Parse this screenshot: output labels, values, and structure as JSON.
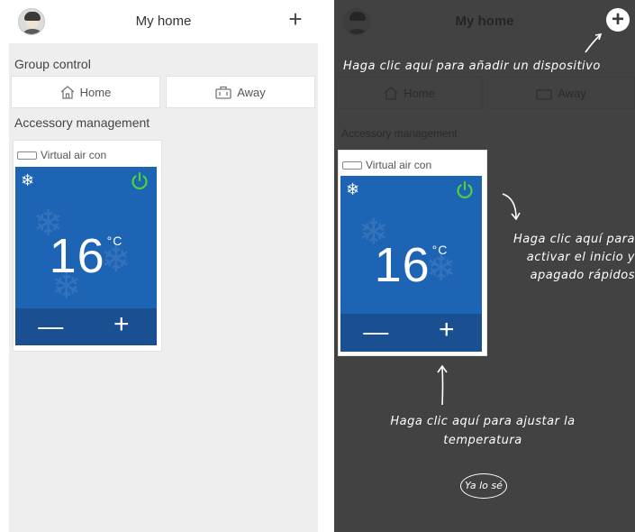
{
  "header": {
    "title": "My home"
  },
  "group_control": {
    "label": "Group control",
    "home_label": "Home",
    "away_label": "Away"
  },
  "accessory": {
    "label": "Accessory management",
    "device_name": "Virtual air con",
    "temperature": "16",
    "unit": "°C",
    "minus": "—",
    "plus": "+"
  },
  "icons": {
    "header_add": "plus-icon",
    "home": "house-icon",
    "away": "suitcase-icon",
    "mode": "snowflake-icon",
    "power": "power-icon"
  },
  "colors": {
    "panel": "#1e64b4",
    "panel_controls": "#1a4f92",
    "power_on": "#4cd137",
    "overlay": "#232323"
  },
  "tutorial": {
    "hint_add": "Haga clic aquí para añadir un dispositivo",
    "hint_power": "Haga clic aquí para activar el inicio y apagado rápidos",
    "hint_temp": "Haga clic aquí para ajustar la temperatura",
    "ok": "Ya lo sé"
  }
}
